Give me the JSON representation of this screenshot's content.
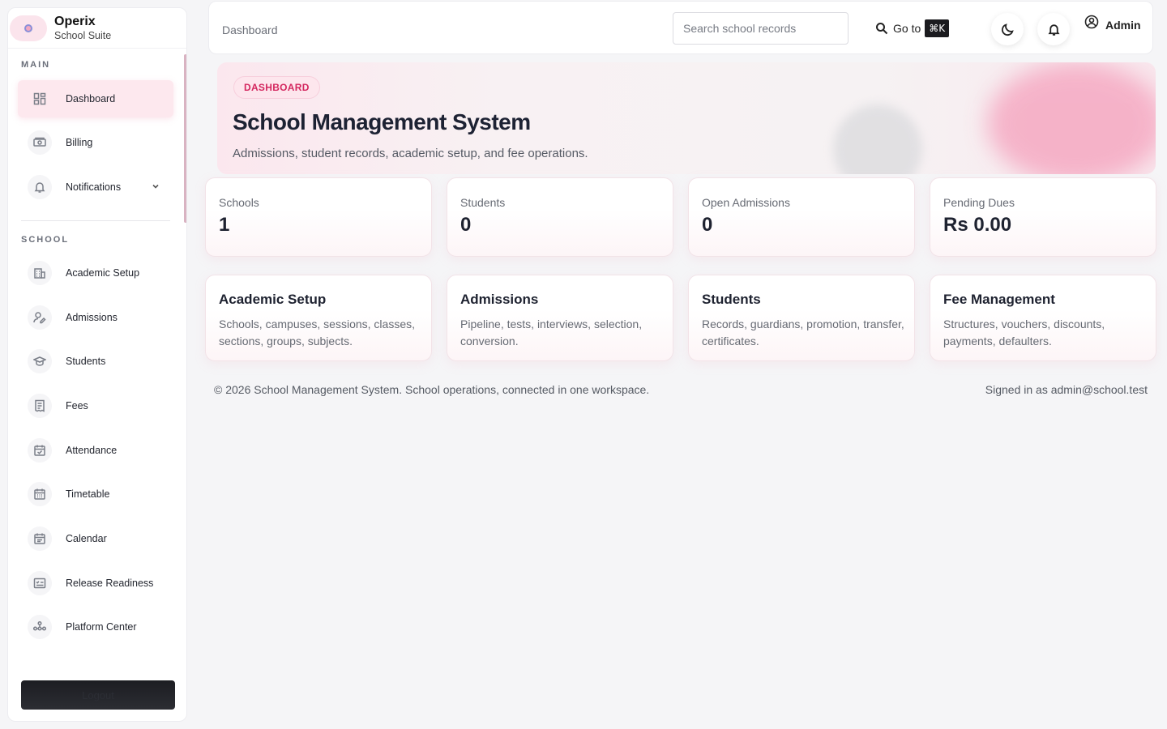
{
  "brand": {
    "name": "Operix",
    "subtitle": "School Suite"
  },
  "sidebar": {
    "main_label": "MAIN",
    "school_label": "SCHOOL",
    "main_items": [
      {
        "label": "Dashboard",
        "icon": "dashboard-grid-icon"
      },
      {
        "label": "Billing",
        "icon": "banknote-icon"
      },
      {
        "label": "Notifications",
        "icon": "bell-icon"
      }
    ],
    "school_items": [
      {
        "label": "Academic Setup",
        "icon": "building-icon"
      },
      {
        "label": "Admissions",
        "icon": "user-edit-icon"
      },
      {
        "label": "Students",
        "icon": "graduation-cap-icon"
      },
      {
        "label": "Fees",
        "icon": "receipt-icon"
      },
      {
        "label": "Attendance",
        "icon": "calendar-check-icon"
      },
      {
        "label": "Timetable",
        "icon": "calendar-grid-icon"
      },
      {
        "label": "Calendar",
        "icon": "calendar-icon"
      },
      {
        "label": "Release Readiness",
        "icon": "checklist-icon"
      },
      {
        "label": "Platform Center",
        "icon": "network-icon"
      }
    ],
    "logout_label": "Logout"
  },
  "topbar": {
    "breadcrumb": "Dashboard",
    "search_placeholder": "Search school records",
    "goto_label": "Go to",
    "goto_shortcut": "⌘K",
    "user_label": "Admin"
  },
  "hero": {
    "badge": "DASHBOARD",
    "title": "School Management System",
    "subtitle": "Admissions, student records, academic setup, and fee operations."
  },
  "stats": [
    {
      "label": "Schools",
      "value": "1"
    },
    {
      "label": "Students",
      "value": "0"
    },
    {
      "label": "Open Admissions",
      "value": "0"
    },
    {
      "label": "Pending Dues",
      "value": "Rs 0.00"
    }
  ],
  "modules": [
    {
      "title": "Academic Setup",
      "desc": "Schools, campuses, sessions, classes, sections, groups, subjects."
    },
    {
      "title": "Admissions",
      "desc": "Pipeline, tests, interviews, selection, conversion."
    },
    {
      "title": "Students",
      "desc": "Records, guardians, promotion, transfer, certificates."
    },
    {
      "title": "Fee Management",
      "desc": "Structures, vouchers, discounts, payments, defaulters."
    }
  ],
  "footer": {
    "copyright": "© 2026 School Management System. School operations, connected in one workspace.",
    "signed_in": "Signed in as admin@school.test"
  },
  "colors": {
    "accent": "#d4275f",
    "accent_bg": "#fde8ee"
  }
}
